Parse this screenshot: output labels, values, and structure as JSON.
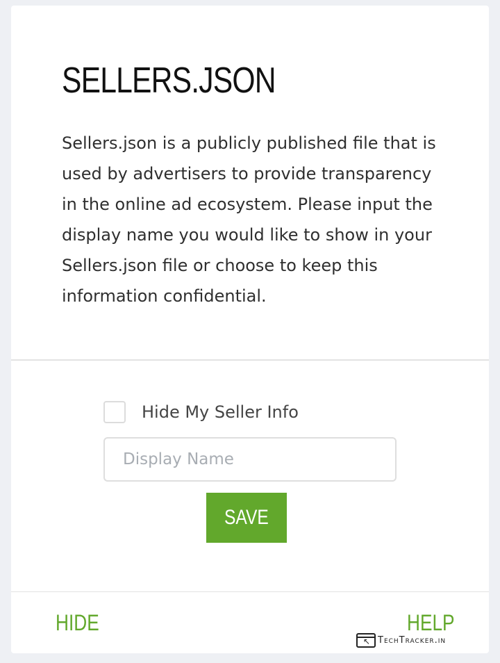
{
  "card": {
    "title": "SELLERS.JSON",
    "description": "Sellers.json is a publicly published file that is used by advertisers to provide transparency in the online ad ecosystem. Please input the display name you would like to show in your Sellers.json file or choose to keep this information confidential."
  },
  "form": {
    "hide_checkbox_label": "Hide My Seller Info",
    "hide_checkbox_checked": false,
    "display_name_value": "",
    "display_name_placeholder": "Display Name",
    "save_label": "SAVE"
  },
  "footer": {
    "hide_label": "HIDE",
    "help_label": "HELP"
  },
  "watermark": {
    "text": "TechTracker.in"
  },
  "colors": {
    "accent": "#62a82c",
    "background": "#eef0f4",
    "card": "#ffffff"
  }
}
